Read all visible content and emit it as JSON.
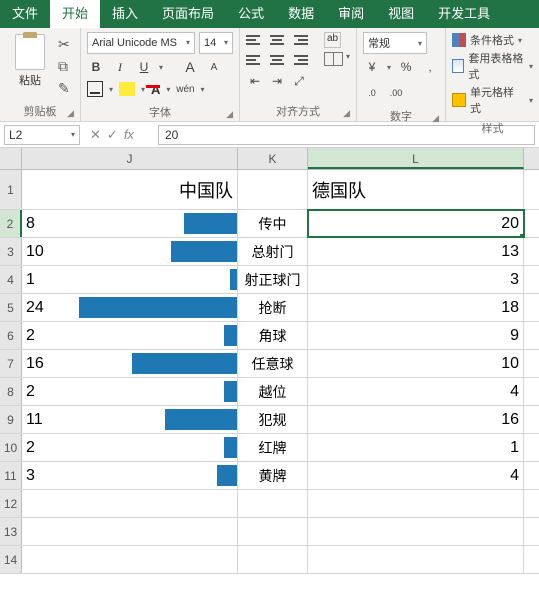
{
  "tabs": {
    "file": "文件",
    "home": "开始",
    "insert": "插入",
    "layout": "页面布局",
    "formulas": "公式",
    "data": "数据",
    "review": "审阅",
    "view": "视图",
    "dev": "开发工具"
  },
  "ribbon": {
    "clipboard": {
      "paste": "粘贴",
      "label": "剪贴板"
    },
    "font": {
      "name": "Arial Unicode MS",
      "size": "14",
      "grow": "A",
      "shrink": "A",
      "wen": "wén",
      "label": "字体"
    },
    "align": {
      "ab": "ab",
      "label": "对齐方式"
    },
    "number": {
      "format": "常规",
      "percent": "%",
      "comma": ",",
      "inc": ".0",
      "dec": ".00",
      "label": "数字"
    },
    "styles": {
      "cond": "条件格式",
      "table": "套用表格格式",
      "cell": "单元格样式",
      "label": "样式"
    }
  },
  "fbar": {
    "name": "L2",
    "formula": "20",
    "fx": "fx"
  },
  "cols": {
    "J": "J",
    "K": "K",
    "L": "L"
  },
  "headers": {
    "J": "中国队",
    "L": "德国队"
  },
  "data_rows": [
    {
      "r": "2",
      "j": "8",
      "k": "传中",
      "l": "20",
      "jbar": 53
    },
    {
      "r": "3",
      "j": "10",
      "k": "总射门",
      "l": "13",
      "jbar": 66
    },
    {
      "r": "4",
      "j": "1",
      "k": "射正球门",
      "l": "3",
      "jbar": 7
    },
    {
      "r": "5",
      "j": "24",
      "k": "抢断",
      "l": "18",
      "jbar": 158
    },
    {
      "r": "6",
      "j": "2",
      "k": "角球",
      "l": "9",
      "jbar": 13
    },
    {
      "r": "7",
      "j": "16",
      "k": "任意球",
      "l": "10",
      "jbar": 105
    },
    {
      "r": "8",
      "j": "2",
      "k": "越位",
      "l": "4",
      "jbar": 13
    },
    {
      "r": "9",
      "j": "11",
      "k": "犯规",
      "l": "16",
      "jbar": 72
    },
    {
      "r": "10",
      "j": "2",
      "k": "红牌",
      "l": "1",
      "jbar": 13
    },
    {
      "r": "11",
      "j": "3",
      "k": "黄牌",
      "l": "4",
      "jbar": 20
    }
  ],
  "empty_rows": [
    "12",
    "13",
    "14"
  ],
  "chart_data": {
    "type": "bar",
    "title": "",
    "series": [
      {
        "name": "中国队",
        "values": [
          8,
          10,
          1,
          24,
          2,
          16,
          2,
          11,
          2,
          3
        ]
      },
      {
        "name": "德国队",
        "values": [
          20,
          13,
          3,
          18,
          9,
          10,
          4,
          16,
          1,
          4
        ]
      }
    ],
    "categories": [
      "传中",
      "总射门",
      "射正球门",
      "抢断",
      "角球",
      "任意球",
      "越位",
      "犯规",
      "红牌",
      "黄牌"
    ],
    "note": "In-cell data bars shown only on 中国队 column, right-aligned"
  }
}
